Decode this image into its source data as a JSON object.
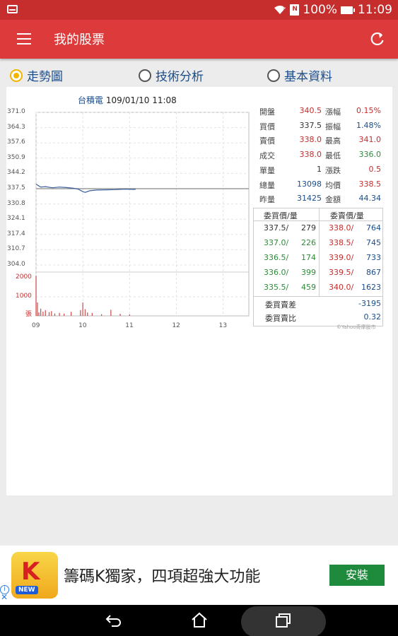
{
  "status_bar": {
    "battery": "100%",
    "time": "11:09",
    "notif_letter": "N"
  },
  "app_bar": {
    "title": "我的股票"
  },
  "tabs": [
    {
      "label": "走勢圖",
      "selected": true
    },
    {
      "label": "技術分析",
      "selected": false
    },
    {
      "label": "基本資料",
      "selected": false
    }
  ],
  "chart_title": {
    "name": "台積電",
    "datetime": "109/01/10 11:08"
  },
  "chart_data": {
    "type": "line",
    "xlabel": "",
    "ylabel": "",
    "price_ticks": [
      "371.0",
      "364.3",
      "357.6",
      "350.9",
      "344.2",
      "337.5",
      "330.8",
      "324.1",
      "317.4",
      "310.7",
      "304.0"
    ],
    "volume_ticks": [
      "2000",
      "1000",
      "張"
    ],
    "x_ticks": [
      "09",
      "10",
      "11",
      "12",
      "13"
    ],
    "ylim": [
      304.0,
      371.0
    ],
    "reference_price": 337.5,
    "series": [
      {
        "x": [
          9.0,
          9.1,
          9.2,
          9.35,
          9.5,
          9.65,
          9.8,
          9.9,
          10.0,
          10.05,
          10.15,
          10.3,
          10.5,
          10.7,
          10.9,
          11.1,
          11.13
        ],
        "values": [
          339.5,
          338.2,
          338.4,
          337.9,
          338.2,
          338.0,
          337.7,
          337.3,
          336.2,
          335.9,
          336.6,
          336.9,
          337.0,
          337.1,
          337.3,
          337.2,
          337.3
        ]
      }
    ],
    "volume": {
      "x": [
        9.0,
        9.03,
        9.06,
        9.1,
        9.15,
        9.2,
        9.28,
        9.33,
        9.4,
        9.5,
        9.6,
        9.75,
        9.95,
        10.0,
        10.05,
        10.1,
        10.2,
        10.4,
        10.6,
        10.8,
        11.0
      ],
      "values": [
        2100,
        700,
        180,
        380,
        220,
        300,
        200,
        250,
        130,
        160,
        120,
        210,
        300,
        700,
        350,
        180,
        150,
        90,
        320,
        110,
        80
      ]
    },
    "ylim_volume": [
      0,
      2000
    ],
    "grid": true
  },
  "quote": {
    "rows": [
      {
        "k1": "開盤",
        "v1": "340.5",
        "c1": "red",
        "k2": "漲幅",
        "v2": "0.15%",
        "c2": "red"
      },
      {
        "k1": "買價",
        "v1": "337.5",
        "c1": "gray",
        "k2": "振幅",
        "v2": "1.48%",
        "c2": "blue"
      },
      {
        "k1": "賣價",
        "v1": "338.0",
        "c1": "red",
        "k2": "最高",
        "v2": "341.0",
        "c2": "red"
      },
      {
        "k1": "成交",
        "v1": "338.0",
        "c1": "red",
        "k2": "最低",
        "v2": "336.0",
        "c2": "green"
      },
      {
        "k1": "單量",
        "v1": "1",
        "c1": "gray",
        "k2": "漲跌",
        "v2": "0.5",
        "c2": "red"
      },
      {
        "k1": "總量",
        "v1": "13098",
        "c1": "blue",
        "k2": "均價",
        "v2": "338.5",
        "c2": "red"
      },
      {
        "k1": "昨量",
        "v1": "31425",
        "c1": "blue",
        "k2": "金額",
        "v2": "44.34",
        "c2": "blue"
      }
    ]
  },
  "order_book": {
    "bid_header": "委買價/量",
    "ask_header": "委賣價/量",
    "rows": [
      {
        "bid": "337.5/",
        "bid_qty": "279",
        "bid_color": "gray",
        "ask": "338.0/",
        "ask_qty": "764"
      },
      {
        "bid": "337.0/",
        "bid_qty": "226",
        "bid_color": "green",
        "ask": "338.5/",
        "ask_qty": "745"
      },
      {
        "bid": "336.5/",
        "bid_qty": "174",
        "bid_color": "green",
        "ask": "339.0/",
        "ask_qty": "733"
      },
      {
        "bid": "336.0/",
        "bid_qty": "399",
        "bid_color": "green",
        "ask": "339.5/",
        "ask_qty": "867"
      },
      {
        "bid": "335.5/",
        "bid_qty": "459",
        "bid_color": "green",
        "ask": "340.0/",
        "ask_qty": "1623"
      }
    ],
    "diff_label": "委買賣差",
    "diff_value": "-3195",
    "ratio_label": "委買賣比",
    "ratio_value": "0.32"
  },
  "source_note": "©Yahoo奇摩股市",
  "ad": {
    "logo_letter": "K",
    "logo_badge": "NEW",
    "text": "籌碼K獨家，四項超強大功能",
    "button": "安裝",
    "info": "i",
    "close": "✕"
  },
  "colors": {
    "red": "#c62d2d",
    "green": "#2e8b3a",
    "blue": "#1a4d8c",
    "install": "#1d8a3c"
  },
  "icons": [
    "mail-icon",
    "wifi-icon",
    "notification-icon",
    "battery-icon",
    "menu-icon",
    "refresh-icon",
    "back-icon",
    "home-icon",
    "recent-apps-icon"
  ]
}
